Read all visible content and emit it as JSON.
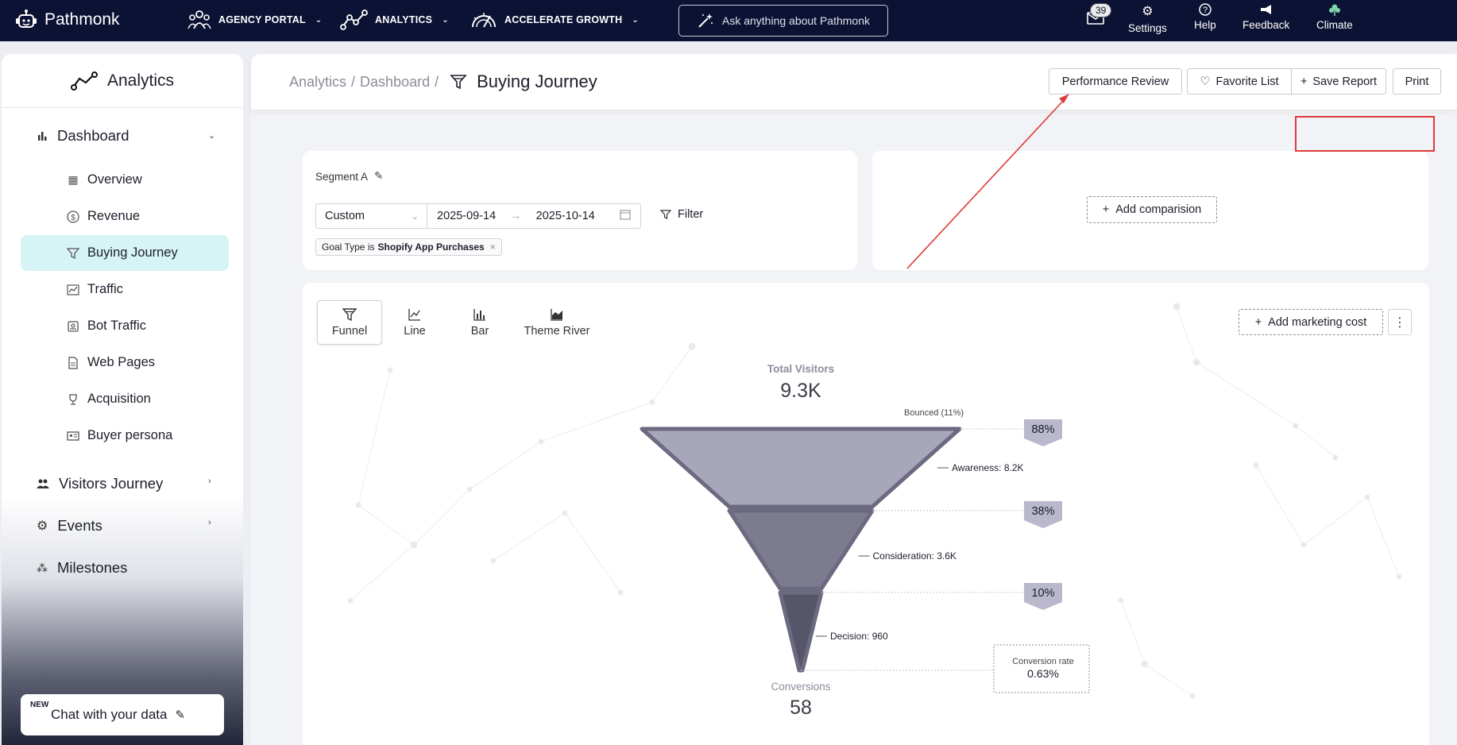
{
  "topbar": {
    "brand": "Pathmonk",
    "nav": [
      {
        "label": "AGENCY PORTAL"
      },
      {
        "label": "ANALYTICS"
      },
      {
        "label": "ACCELERATE GROWTH"
      }
    ],
    "ask_placeholder": "Ask anything about Pathmonk",
    "mail_count": "39",
    "settings": "Settings",
    "help": "Help",
    "feedback": "Feedback",
    "climate": "Climate"
  },
  "sidebar": {
    "title": "Analytics",
    "dashboard": "Dashboard",
    "items": [
      {
        "label": "Overview"
      },
      {
        "label": "Revenue"
      },
      {
        "label": "Buying Journey"
      },
      {
        "label": "Traffic"
      },
      {
        "label": "Bot Traffic"
      },
      {
        "label": "Web Pages"
      },
      {
        "label": "Acquisition"
      },
      {
        "label": "Buyer persona"
      }
    ],
    "visitors_journey": "Visitors Journey",
    "events": "Events",
    "milestones": "Milestones",
    "chat_new": "NEW",
    "chat_label": "Chat with your data"
  },
  "header": {
    "crumb_analytics": "Analytics",
    "crumb_dashboard": "Dashboard",
    "sep": "/",
    "current": "Buying Journey",
    "performance_review": "Performance Review",
    "favorite_list": "Favorite List",
    "save_report": "Save Report",
    "print": "Print"
  },
  "segment": {
    "label": "Segment A",
    "range_preset": "Custom",
    "start_date": "2025-09-14",
    "end_date": "2025-10-14",
    "filter": "Filter",
    "chip_prefix": "Goal Type is",
    "chip_value": "Shopify App Purchases"
  },
  "comparison": {
    "add_label": "Add comparision"
  },
  "chart_tabs": {
    "funnel": "Funnel",
    "line": "Line",
    "bar": "Bar",
    "theme_river": "Theme River",
    "add_marketing_cost": "Add marketing cost"
  },
  "chart_data": {
    "type": "funnel",
    "top_label": "Total Visitors",
    "top_value": "9.3K",
    "bounced_label": "Bounced (11%)",
    "stages": [
      {
        "label": "Awareness: 8.2K",
        "value": 8200,
        "percent": "88%"
      },
      {
        "label": "Consideration: 3.6K",
        "value": 3600,
        "percent": "38%"
      },
      {
        "label": "Decision: 960",
        "value": 960,
        "percent": "10%"
      }
    ],
    "conversion_rate_label": "Conversion rate",
    "conversion_rate": "0.63%",
    "bottom_label": "Conversions",
    "bottom_value": "58",
    "colors": [
      "#a7a6bb",
      "#7c7b90",
      "#56566a"
    ]
  }
}
